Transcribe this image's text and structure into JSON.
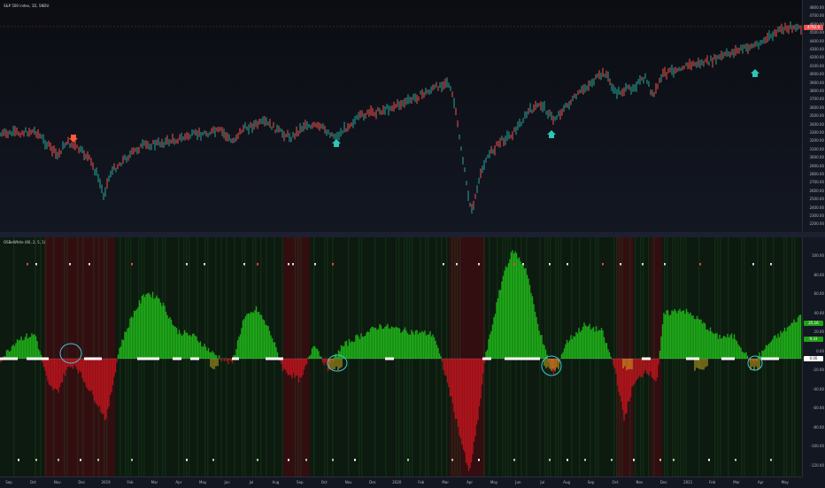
{
  "price_pane": {
    "title": "S&P 500 index, 1D, SNDU",
    "price_badge": "4792.8",
    "axis_ticks": [
      "4800.00",
      "4700.00",
      "4600.00",
      "4500.00",
      "4400.00",
      "4300.00",
      "4200.00",
      "4100.00",
      "4000.00",
      "3900.00",
      "3800.00",
      "3700.00",
      "3600.00",
      "3500.00",
      "3400.00",
      "3300.00",
      "3200.00",
      "3100.00",
      "3000.00",
      "2900.00",
      "2800.00",
      "2700.00",
      "2600.00",
      "2500.00",
      "2400.00",
      "2300.00",
      "2200.00"
    ],
    "colors": {
      "up": "#26a69a",
      "down": "#ef5350",
      "sell_arrow": "#ff5b3a",
      "buy_arrow": "#2ec4b6"
    }
  },
  "osc_pane": {
    "title": "OSBeWhite (60, 2, 5, 1)",
    "axis_ticks": [
      "100.00",
      "80.00",
      "60.00",
      "40.00",
      "20.00",
      "0.00",
      "-20.00",
      "-40.00",
      "-60.00",
      "-80.00",
      "-100.00",
      "-120.00"
    ],
    "badges": [
      "25.16",
      "9.33",
      "0.00"
    ],
    "colors": {
      "positive": "#22c21a",
      "negative": "#c8141e",
      "zero_marker": "#ffffff",
      "circle": "#3fc6d8"
    }
  },
  "time_axis": [
    "Sep",
    "Oct",
    "Nov",
    "Dec",
    "2019",
    "Feb",
    "Mar",
    "Apr",
    "May",
    "Jun",
    "Jul",
    "Aug",
    "Sep",
    "Oct",
    "Nov",
    "Dec",
    "2020",
    "Feb",
    "Mar",
    "Apr",
    "May",
    "Jun",
    "Jul",
    "Aug",
    "Sep",
    "Oct",
    "Nov",
    "Dec",
    "2021",
    "Feb",
    "Mar",
    "Apr",
    "May"
  ]
}
